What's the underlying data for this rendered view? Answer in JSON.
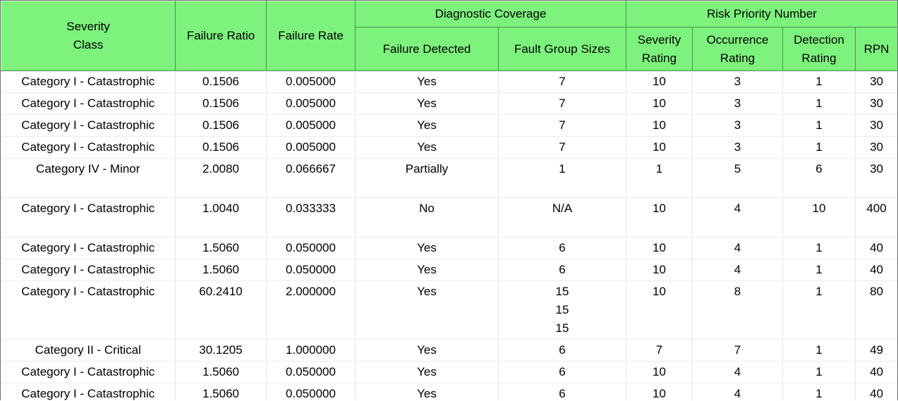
{
  "headers": {
    "severity_class": [
      "Severity",
      "Class"
    ],
    "failure_ratio": "Failure Ratio",
    "failure_rate": "Failure Rate",
    "diagnostic_coverage": "Diagnostic Coverage",
    "failure_detected": "Failure Detected",
    "fault_group_sizes": "Fault Group Sizes",
    "risk_priority_number": "Risk Priority Number",
    "severity_rating": [
      "Severity",
      "Rating"
    ],
    "occurrence_rating": [
      "Occurrence",
      "Rating"
    ],
    "detection_rating": [
      "Detection",
      "Rating"
    ],
    "rpn": "RPN"
  },
  "rows": [
    {
      "severity_class": "Category I - Catastrophic",
      "failure_ratio": "0.1506",
      "failure_rate": "0.005000",
      "failure_detected": "Yes",
      "fault_group_sizes": [
        "7"
      ],
      "severity_rating": "10",
      "occurrence_rating": "3",
      "detection_rating": "1",
      "rpn": "30"
    },
    {
      "severity_class": "Category I - Catastrophic",
      "failure_ratio": "0.1506",
      "failure_rate": "0.005000",
      "failure_detected": "Yes",
      "fault_group_sizes": [
        "7"
      ],
      "severity_rating": "10",
      "occurrence_rating": "3",
      "detection_rating": "1",
      "rpn": "30"
    },
    {
      "severity_class": "Category I - Catastrophic",
      "failure_ratio": "0.1506",
      "failure_rate": "0.005000",
      "failure_detected": "Yes",
      "fault_group_sizes": [
        "7"
      ],
      "severity_rating": "10",
      "occurrence_rating": "3",
      "detection_rating": "1",
      "rpn": "30"
    },
    {
      "severity_class": "Category I - Catastrophic",
      "failure_ratio": "0.1506",
      "failure_rate": "0.005000",
      "failure_detected": "Yes",
      "fault_group_sizes": [
        "7"
      ],
      "severity_rating": "10",
      "occurrence_rating": "3",
      "detection_rating": "1",
      "rpn": "30"
    },
    {
      "severity_class": "Category IV - Minor",
      "failure_ratio": "2.0080",
      "failure_rate": "0.066667",
      "failure_detected": "Partially",
      "fault_group_sizes": [
        "1"
      ],
      "severity_rating": "1",
      "occurrence_rating": "5",
      "detection_rating": "6",
      "rpn": "30"
    },
    {
      "severity_class": "Category I - Catastrophic",
      "failure_ratio": "1.0040",
      "failure_rate": "0.033333",
      "failure_detected": "No",
      "fault_group_sizes": [
        "N/A"
      ],
      "severity_rating": "10",
      "occurrence_rating": "4",
      "detection_rating": "10",
      "rpn": "400"
    },
    {
      "severity_class": "Category I - Catastrophic",
      "failure_ratio": "1.5060",
      "failure_rate": "0.050000",
      "failure_detected": "Yes",
      "fault_group_sizes": [
        "6"
      ],
      "severity_rating": "10",
      "occurrence_rating": "4",
      "detection_rating": "1",
      "rpn": "40"
    },
    {
      "severity_class": "Category I - Catastrophic",
      "failure_ratio": "1.5060",
      "failure_rate": "0.050000",
      "failure_detected": "Yes",
      "fault_group_sizes": [
        "6"
      ],
      "severity_rating": "10",
      "occurrence_rating": "4",
      "detection_rating": "1",
      "rpn": "40"
    },
    {
      "severity_class": "Category I - Catastrophic",
      "failure_ratio": "60.2410",
      "failure_rate": "2.000000",
      "failure_detected": "Yes",
      "fault_group_sizes": [
        "15",
        "15",
        "15"
      ],
      "severity_rating": "10",
      "occurrence_rating": "8",
      "detection_rating": "1",
      "rpn": "80"
    },
    {
      "severity_class": "Category II - Critical",
      "failure_ratio": "30.1205",
      "failure_rate": "1.000000",
      "failure_detected": "Yes",
      "fault_group_sizes": [
        "6"
      ],
      "severity_rating": "7",
      "occurrence_rating": "7",
      "detection_rating": "1",
      "rpn": "49"
    },
    {
      "severity_class": "Category I - Catastrophic",
      "failure_ratio": "1.5060",
      "failure_rate": "0.050000",
      "failure_detected": "Yes",
      "fault_group_sizes": [
        "6"
      ],
      "severity_rating": "10",
      "occurrence_rating": "4",
      "detection_rating": "1",
      "rpn": "40"
    },
    {
      "severity_class": "Category I - Catastrophic",
      "failure_ratio": "1.5060",
      "failure_rate": "0.050000",
      "failure_detected": "Yes",
      "fault_group_sizes": [
        "6"
      ],
      "severity_rating": "10",
      "occurrence_rating": "4",
      "detection_rating": "1",
      "rpn": "40"
    }
  ],
  "colors": {
    "header_bg": "#7df27d",
    "grid_line": "#e6e6e6",
    "text": "#000000"
  }
}
